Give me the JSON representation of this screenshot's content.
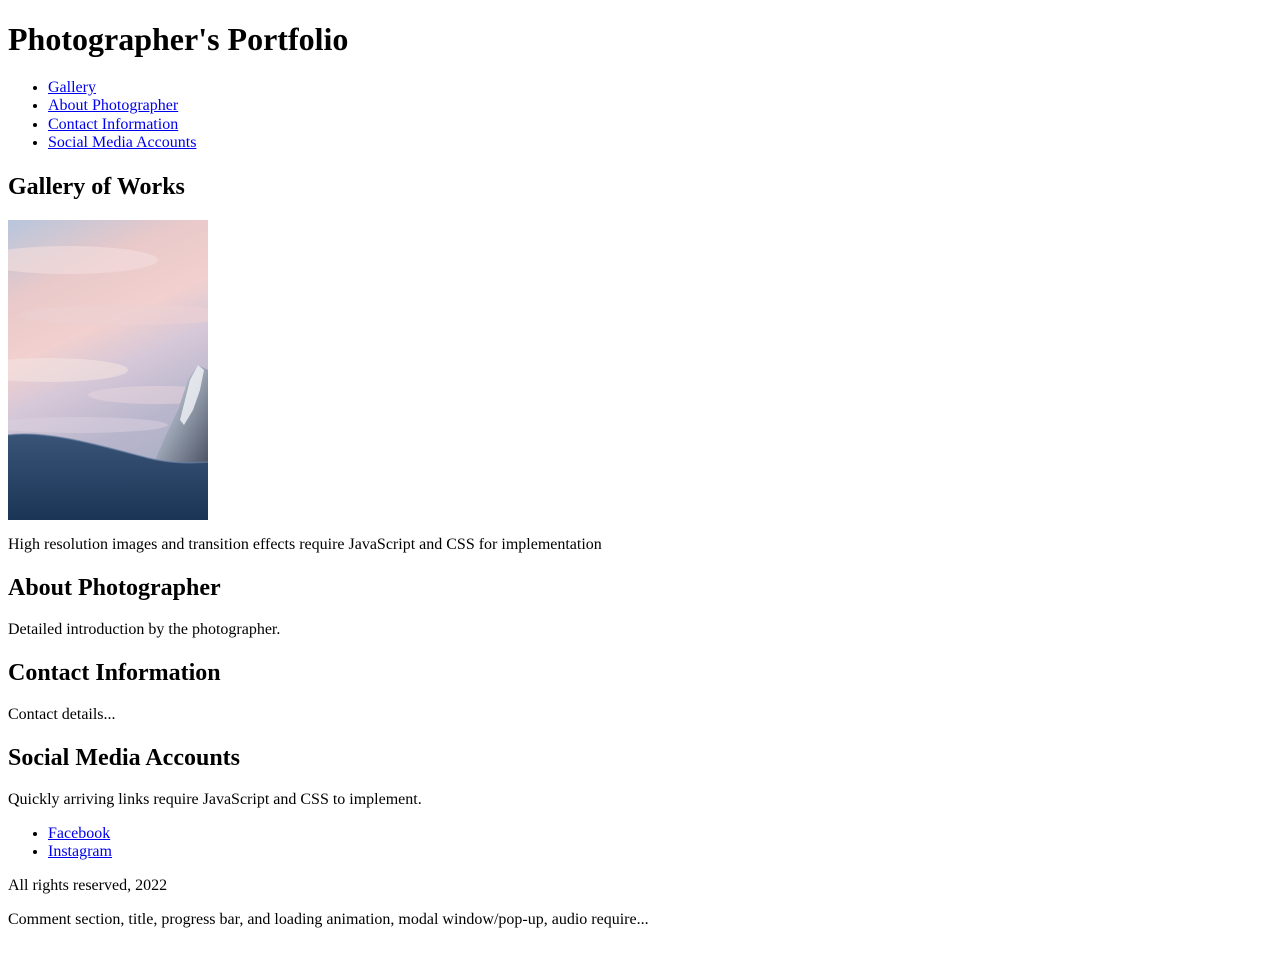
{
  "header": {
    "title": "Photographer's Portfolio"
  },
  "nav": {
    "items": [
      {
        "label": "Gallery"
      },
      {
        "label": "About Photographer"
      },
      {
        "label": "Contact Information"
      },
      {
        "label": "Social Media Accounts"
      }
    ]
  },
  "gallery": {
    "heading": "Gallery of Works",
    "image_subject": "snowy-mountain-at-sunset-photo",
    "note": "High resolution images and transition effects require JavaScript and CSS for implementation"
  },
  "about": {
    "heading": "About Photographer",
    "text": "Detailed introduction by the photographer."
  },
  "contact": {
    "heading": "Contact Information",
    "text": "Contact details..."
  },
  "social": {
    "heading": "Social Media Accounts",
    "text": "Quickly arriving links require JavaScript and CSS to implement.",
    "links": [
      {
        "label": "Facebook"
      },
      {
        "label": "Instagram"
      }
    ]
  },
  "footer": {
    "copyright": "All rights reserved, 2022",
    "note": "Comment section, title, progress bar, and loading animation, modal window/pop-up, audio require..."
  },
  "colors": {
    "link": "#0000ee",
    "text": "#000000",
    "background": "#ffffff"
  }
}
